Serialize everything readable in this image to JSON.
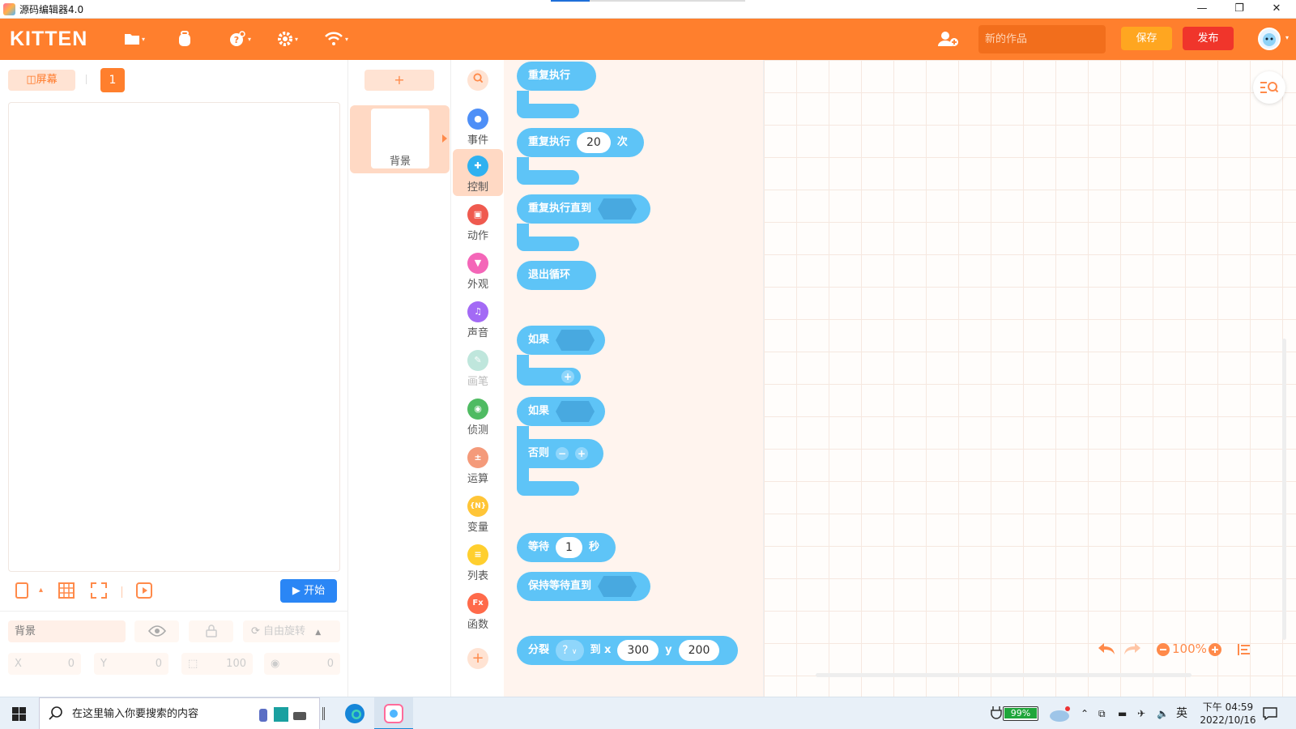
{
  "window": {
    "title": "源码编辑器4.0",
    "controls": {
      "minimize": "—",
      "restore": "❐",
      "close": "✕"
    }
  },
  "topbar": {
    "logo": "KITTEN",
    "works_placeholder": "新的作品",
    "save_label": "保存",
    "publish_label": "发布",
    "icons": [
      "folder-icon",
      "backpack-icon",
      "help-icon",
      "settings-icon",
      "wifi-icon",
      "add-user-icon"
    ]
  },
  "stage": {
    "screen_label": "屏幕",
    "screen_number": "1",
    "start_label": "开始",
    "props": {
      "name": "背景",
      "rotation_label": "自由旋转",
      "x_label": "X",
      "x_value": "0",
      "y_label": "Y",
      "y_value": "0",
      "size_value": "100",
      "direction_value": "0"
    }
  },
  "sprites": {
    "add_label": "+",
    "items": [
      {
        "label": "背景"
      }
    ]
  },
  "categories": [
    {
      "label": "事件",
      "color": "#4e8ff7",
      "active": false
    },
    {
      "label": "控制",
      "color": "#2fb1f0",
      "active": true
    },
    {
      "label": "动作",
      "color": "#ef5a4f",
      "active": false
    },
    {
      "label": "外观",
      "color": "#f466b8",
      "active": false
    },
    {
      "label": "声音",
      "color": "#a36af5",
      "active": false
    },
    {
      "label": "画笔",
      "color": "#bfe6dc",
      "active": false
    },
    {
      "label": "侦测",
      "color": "#4fbb62",
      "active": false
    },
    {
      "label": "运算",
      "color": "#f49a7a",
      "active": false
    },
    {
      "label": "变量",
      "color": "#ffc537",
      "active": false
    },
    {
      "label": "列表",
      "color": "#ffcf2e",
      "active": false
    },
    {
      "label": "函数",
      "color": "#ff6a4a",
      "active": false
    }
  ],
  "blocks": {
    "repeat_forever": "重复执行",
    "repeat_times_prefix": "重复执行",
    "repeat_times_value": "20",
    "repeat_times_suffix": "次",
    "repeat_until": "重复执行直到",
    "break_loop": "退出循环",
    "if_label": "如果",
    "if_else_if": "如果",
    "else_label": "否则",
    "wait_prefix": "等待",
    "wait_value": "1",
    "wait_suffix": "秒",
    "wait_until": "保持等待直到",
    "split_label": "分裂",
    "split_target": "?",
    "split_to_x": "到 x",
    "split_x": "300",
    "split_y_label": "y",
    "split_y": "200"
  },
  "canvas": {
    "zoom": "100%"
  },
  "taskbar": {
    "search_placeholder": "在这里输入你要搜索的内容",
    "battery": "99%",
    "ime": "英",
    "time": "下午 04:59",
    "date": "2022/10/16"
  }
}
